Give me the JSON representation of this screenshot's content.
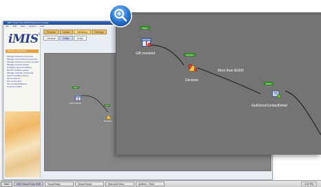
{
  "window": {
    "title": "iMIS Visual Tools (iMIS Business Processes)",
    "menu": [
      "File",
      "Edit",
      "View",
      "Options",
      "Help"
    ]
  },
  "sidebar": {
    "logo": "iMIS",
    "logo_mark": "15",
    "header": "Business Processes",
    "items": [
      "Manage business processes",
      "Manage new business processes",
      "Manage business process templates",
      "Manage process activity",
      "Configure process tracking",
      "Monitor workflow queue",
      "Manage workflow monitoring",
      "Search workflow history",
      "Set up actions",
      "Set up Domains",
      "Set up Rules/Filtering",
      "Connect to iMIS"
    ]
  },
  "tabs": [
    "Process",
    "Action",
    "Workflow",
    "Settings"
  ],
  "subtabs": [
    "General",
    "Editor",
    "Script"
  ],
  "background_flow": {
    "tags": [
      "trigger",
      "check",
      "action"
    ],
    "nodes": [
      "Gift received",
      "Decision"
    ]
  },
  "flow": {
    "start_tag": "trigger",
    "start_label": "Gift received",
    "decision_tag": "decision",
    "decision_label": "Decision",
    "condition_label": "More than $1000",
    "action_tag": "action",
    "action_label": "GetDonorContactDetail"
  },
  "taskbar": {
    "start": "Start",
    "tasks": [
      "iMIS Visual Tools iMIS",
      "Visual Basic",
      "Visual Studio",
      "Microsoft Word",
      "Untitled - Paint"
    ],
    "clock": "4:32 PM"
  },
  "colors": {
    "canvas": "#747474",
    "tag_green": "#3e9b2f",
    "wire": "#1e1e1e",
    "lens": "#2d7bd6",
    "logo": "#2c3f8c"
  },
  "icons": [
    "magnifier-icon",
    "gift-icon",
    "decision-icon",
    "action-icon"
  ]
}
